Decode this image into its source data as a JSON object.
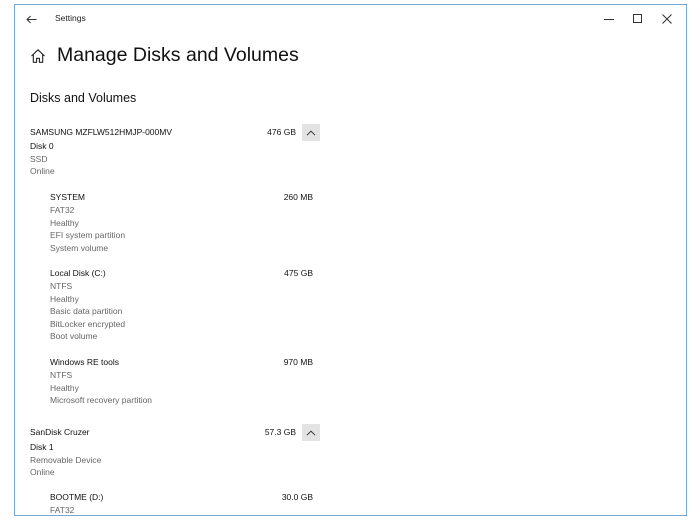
{
  "window": {
    "title": "Settings"
  },
  "header": {
    "title": "Manage Disks and Volumes"
  },
  "section": {
    "title": "Disks and Volumes"
  },
  "disks": [
    {
      "name": "SAMSUNG MZFLW512HMJP-000MV",
      "size": "476 GB",
      "details": [
        "Disk 0",
        "SSD",
        "Online"
      ],
      "volumes": [
        {
          "name": "SYSTEM",
          "size": "260 MB",
          "details": [
            "FAT32",
            "Healthy",
            "EFI system partition",
            "System volume"
          ]
        },
        {
          "name": "Local Disk (C:)",
          "size": "475 GB",
          "details": [
            "NTFS",
            "Healthy",
            "Basic data partition",
            "BitLocker encrypted",
            "Boot volume"
          ]
        },
        {
          "name": "Windows RE tools",
          "size": "970 MB",
          "details": [
            "NTFS",
            "Healthy",
            "Microsoft recovery partition"
          ]
        }
      ]
    },
    {
      "name": "SanDisk Cruzer",
      "size": "57.3 GB",
      "details": [
        "Disk 1",
        "Removable Device",
        "Online"
      ],
      "volumes": [
        {
          "name": "BOOTME (D:)",
          "size": "30.0 GB",
          "details": [
            "FAT32"
          ]
        }
      ]
    }
  ]
}
